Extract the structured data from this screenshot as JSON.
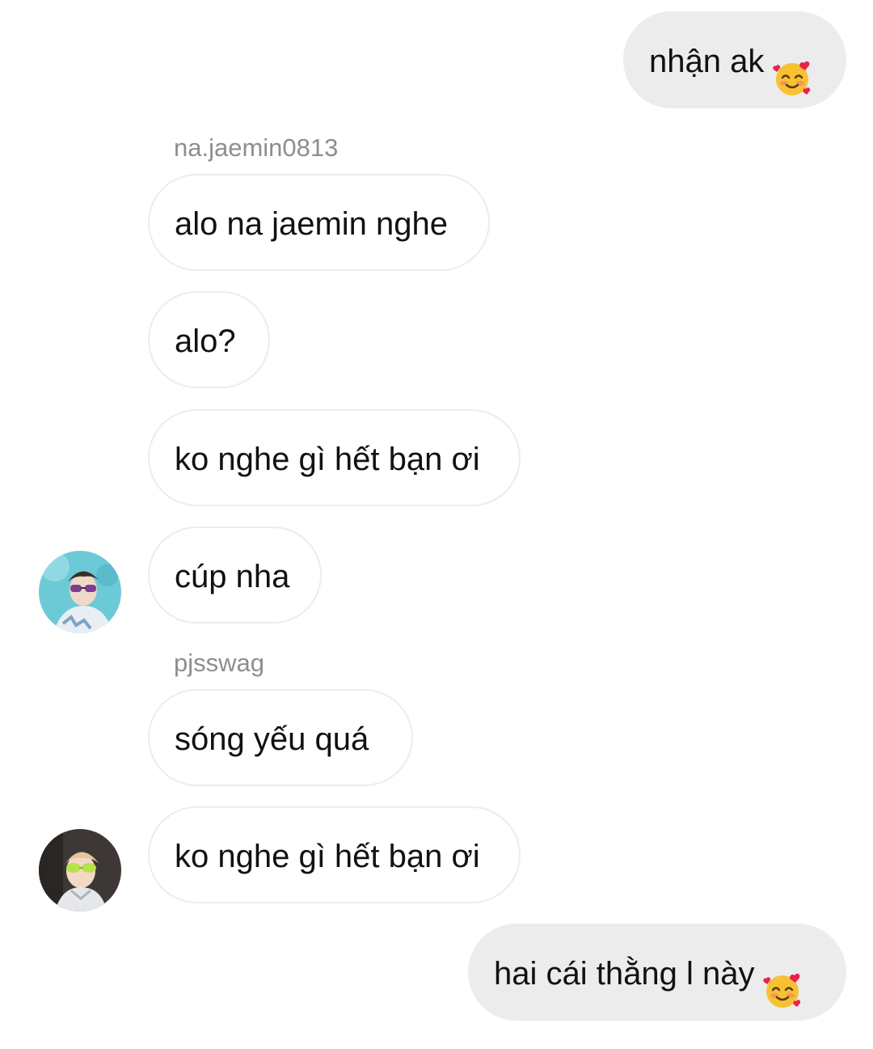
{
  "conversation": {
    "messages": [
      {
        "direction": "out",
        "text": "nhận ak",
        "emoji": "smiling-face-with-hearts-icon"
      },
      {
        "direction": "in",
        "sender": "na.jaemin0813",
        "text": "alo na jaemin nghe"
      },
      {
        "direction": "in",
        "text": "alo?"
      },
      {
        "direction": "in",
        "text": "ko nghe gì hết bạn ơi"
      },
      {
        "direction": "in",
        "text": "cúp nha",
        "avatar": "avatar-na-jaemin0813"
      },
      {
        "direction": "in",
        "sender": "pjsswag",
        "text": "sóng yếu quá"
      },
      {
        "direction": "in",
        "text": "ko nghe gì hết bạn ơi",
        "avatar": "avatar-pjsswag"
      },
      {
        "direction": "out",
        "text": "hai cái thằng l này",
        "emoji": "smiling-face-with-hearts-icon"
      }
    ]
  },
  "colors": {
    "incoming_bubble": "#ffffff",
    "incoming_border": "#ececec",
    "outgoing_bubble": "#ececec",
    "sender_name": "#8e8e8e",
    "text": "#111111"
  }
}
